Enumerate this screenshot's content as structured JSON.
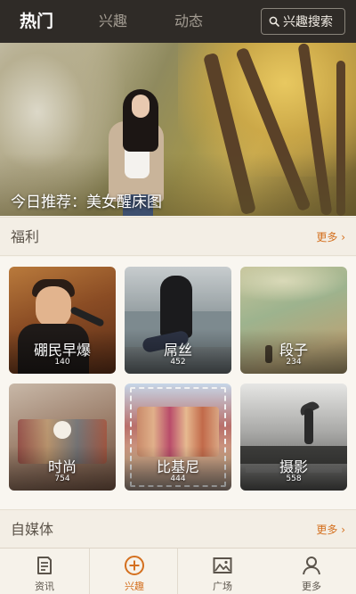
{
  "header": {
    "tabs": [
      {
        "label": "热门",
        "active": true
      },
      {
        "label": "兴趣",
        "active": false
      },
      {
        "label": "动态",
        "active": false
      }
    ],
    "search_label": "兴趣搜索",
    "search_icon": "search-icon"
  },
  "banner": {
    "caption": "今日推荐：美女醒床图"
  },
  "welfare": {
    "title": "福利",
    "more": "更多 ›",
    "cards": [
      {
        "label": "硼民早爆",
        "count": "140"
      },
      {
        "label": "屌丝",
        "count": "452"
      },
      {
        "label": "段子",
        "count": "234"
      },
      {
        "label": "时尚",
        "count": "754"
      },
      {
        "label": "比基尼",
        "count": "444"
      },
      {
        "label": "摄影",
        "count": "558"
      }
    ]
  },
  "media": {
    "title": "自媒体",
    "more": "更多 ›"
  },
  "bottom_nav": {
    "items": [
      {
        "label": "资讯",
        "icon": "document-icon",
        "active": false
      },
      {
        "label": "兴趣",
        "icon": "plus-circle-icon",
        "active": true
      },
      {
        "label": "广场",
        "icon": "image-icon",
        "active": false
      },
      {
        "label": "更多",
        "icon": "person-icon",
        "active": false
      }
    ]
  },
  "colors": {
    "header_bg": "#2f2b27",
    "accent": "#d4701f",
    "page_bg": "#f6f2ea"
  }
}
